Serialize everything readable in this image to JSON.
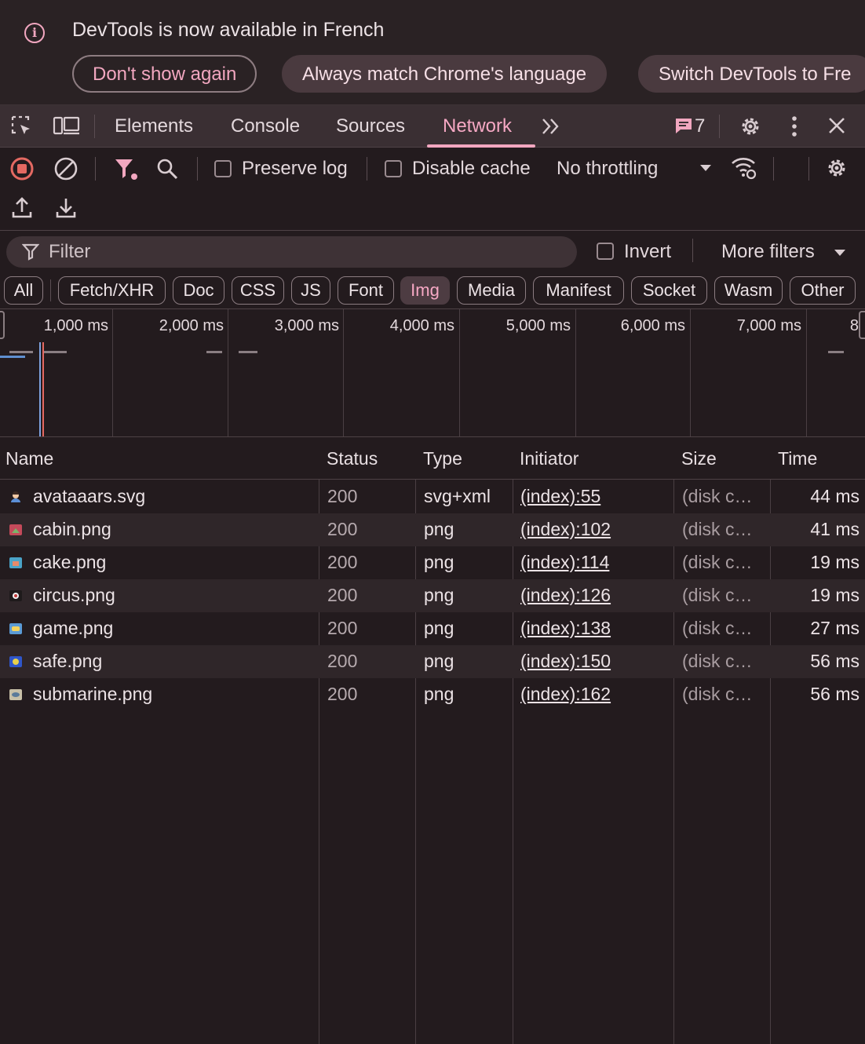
{
  "infobar": {
    "message": "DevTools is now available in French",
    "dont_show": "Don't show again",
    "always_match": "Always match Chrome's language",
    "switch": "Switch DevTools to Fre"
  },
  "tabs": {
    "elements": "Elements",
    "console": "Console",
    "sources": "Sources",
    "network": "Network",
    "more": "»",
    "issues_count": "7"
  },
  "toolbar": {
    "preserve_log": "Preserve log",
    "disable_cache": "Disable cache",
    "throttling": "No throttling"
  },
  "filter": {
    "placeholder": "Filter",
    "invert": "Invert",
    "more_filters": "More filters"
  },
  "type_filters": [
    "All",
    "Fetch/XHR",
    "Doc",
    "CSS",
    "JS",
    "Font",
    "Img",
    "Media",
    "Manifest",
    "Socket",
    "Wasm",
    "Other"
  ],
  "active_type_filter": "Img",
  "timeline": {
    "ticks": [
      "1,000 ms",
      "2,000 ms",
      "3,000 ms",
      "4,000 ms",
      "5,000 ms",
      "6,000 ms",
      "7,000 ms",
      "8"
    ]
  },
  "table": {
    "headers": {
      "name": "Name",
      "status": "Status",
      "type": "Type",
      "initiator": "Initiator",
      "size": "Size",
      "time": "Time"
    },
    "rows": [
      {
        "name": "avataaars.svg",
        "status": "200",
        "type": "svg+xml",
        "initiator": "(index):55",
        "size": "(disk c…",
        "time": "44 ms"
      },
      {
        "name": "cabin.png",
        "status": "200",
        "type": "png",
        "initiator": "(index):102",
        "size": "(disk c…",
        "time": "41 ms"
      },
      {
        "name": "cake.png",
        "status": "200",
        "type": "png",
        "initiator": "(index):114",
        "size": "(disk c…",
        "time": "19 ms"
      },
      {
        "name": "circus.png",
        "status": "200",
        "type": "png",
        "initiator": "(index):126",
        "size": "(disk c…",
        "time": "19 ms"
      },
      {
        "name": "game.png",
        "status": "200",
        "type": "png",
        "initiator": "(index):138",
        "size": "(disk c…",
        "time": "27 ms"
      },
      {
        "name": "safe.png",
        "status": "200",
        "type": "png",
        "initiator": "(index):150",
        "size": "(disk c…",
        "time": "56 ms"
      },
      {
        "name": "submarine.png",
        "status": "200",
        "type": "png",
        "initiator": "(index):162",
        "size": "(disk c…",
        "time": "56 ms"
      }
    ]
  },
  "colors": {
    "accent": "#f2a7c0",
    "record_red": "#e46962",
    "background": "#231b1e"
  }
}
